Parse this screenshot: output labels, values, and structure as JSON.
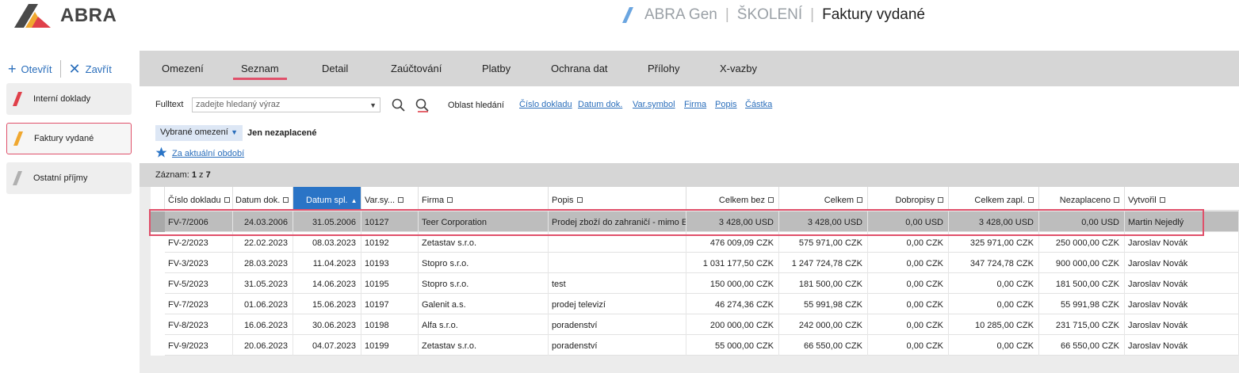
{
  "app": {
    "logo_text": "ABRA",
    "breadcrumb": [
      "ABRA Gen",
      "ŠKOLENÍ",
      "Faktury vydané"
    ]
  },
  "left": {
    "open_label": "Otevřít",
    "close_label": "Zavřít",
    "agendas": [
      {
        "label": "Interní doklady",
        "color": "#e0404a"
      },
      {
        "label": "Faktury vydané",
        "color": "#f0a830"
      },
      {
        "label": "Ostatní příjmy",
        "color": "#b0b0b0"
      }
    ]
  },
  "tabs": [
    "Omezení",
    "Seznam",
    "Detail",
    "Zaúčtování",
    "Platby",
    "Ochrana dat",
    "Přílohy",
    "X-vazby"
  ],
  "active_tab": "Seznam",
  "filter": {
    "fulltext_label": "Fulltext",
    "fulltext_placeholder": "zadejte hledaný výraz",
    "area_label": "Oblast hledání",
    "area_links": [
      "Číslo dokladu",
      "Datum dok.",
      "Var.symbol",
      "Firma",
      "Popis",
      "Částka"
    ],
    "restriction_select": "Vybrané omezení",
    "restriction_value": "Jen nezaplacené",
    "period_link": "Za aktuální období"
  },
  "records": {
    "label": "Záznam:",
    "current": "1",
    "of": "z",
    "total": "7"
  },
  "table": {
    "columns": [
      "Číslo dokladu",
      "Datum dok.",
      "Datum spl.",
      "Var.sy...",
      "Firma",
      "Popis",
      "Celkem bez",
      "Celkem",
      "Dobropisy",
      "Celkem zapl.",
      "Nezaplaceno",
      "Vytvořil"
    ],
    "sorted_column": "Datum spl.",
    "rows": [
      [
        "FV-7/2006",
        "24.03.2006",
        "31.05.2006",
        "10127",
        "Teer Corporation",
        "Prodej zboží do zahraničí - mimo EU",
        "3 428,00 USD",
        "3 428,00 USD",
        "0,00 USD",
        "3 428,00 USD",
        "0,00 USD",
        "Martin Nejedlý"
      ],
      [
        "FV-2/2023",
        "22.02.2023",
        "08.03.2023",
        "10192",
        "Zetastav s.r.o.",
        "",
        "476 009,09 CZK",
        "575 971,00 CZK",
        "0,00 CZK",
        "325 971,00 CZK",
        "250 000,00 CZK",
        "Jaroslav Novák"
      ],
      [
        "FV-3/2023",
        "28.03.2023",
        "11.04.2023",
        "10193",
        "Stopro s.r.o.",
        "",
        "1 031 177,50 CZK",
        "1 247 724,78 CZK",
        "0,00 CZK",
        "347 724,78 CZK",
        "900 000,00 CZK",
        "Jaroslav Novák"
      ],
      [
        "FV-5/2023",
        "31.05.2023",
        "14.06.2023",
        "10195",
        "Stopro s.r.o.",
        "test",
        "150 000,00 CZK",
        "181 500,00 CZK",
        "0,00 CZK",
        "0,00 CZK",
        "181 500,00 CZK",
        "Jaroslav Novák"
      ],
      [
        "FV-7/2023",
        "01.06.2023",
        "15.06.2023",
        "10197",
        "Galenit a.s.",
        "prodej televizí",
        "46 274,36 CZK",
        "55 991,98 CZK",
        "0,00 CZK",
        "0,00 CZK",
        "55 991,98 CZK",
        "Jaroslav Novák"
      ],
      [
        "FV-8/2023",
        "16.06.2023",
        "30.06.2023",
        "10198",
        "Alfa s.r.o.",
        "poradenství",
        "200 000,00 CZK",
        "242 000,00 CZK",
        "0,00 CZK",
        "10 285,00 CZK",
        "231 715,00 CZK",
        "Jaroslav Novák"
      ],
      [
        "FV-9/2023",
        "20.06.2023",
        "04.07.2023",
        "10199",
        "Zetastav s.r.o.",
        "poradenství",
        "55 000,00 CZK",
        "66 550,00 CZK",
        "0,00 CZK",
        "0,00 CZK",
        "66 550,00 CZK",
        "Jaroslav Novák"
      ]
    ]
  },
  "colors": {
    "accent": "#e0506a",
    "link": "#2a6ebb",
    "sorted_header": "#2a74c6"
  }
}
